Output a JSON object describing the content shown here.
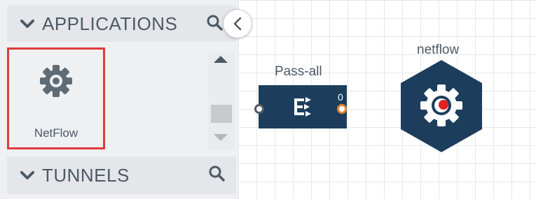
{
  "sidebar": {
    "applications": {
      "title": "APPLICATIONS",
      "items": [
        {
          "label": "NetFlow",
          "icon": "gear-icon",
          "selected": true
        }
      ]
    },
    "tunnels": {
      "title": "TUNNELS"
    }
  },
  "canvas": {
    "map_node": {
      "label": "Pass-all",
      "port_count": "0",
      "icon": "map-icon"
    },
    "app_node": {
      "label": "netflow",
      "icon": "gear-icon"
    }
  },
  "colors": {
    "node_fill": "#1d3d5c",
    "selection_border": "#e03b3b",
    "output_port": "#e08a30",
    "status_dot": "#e02020"
  }
}
